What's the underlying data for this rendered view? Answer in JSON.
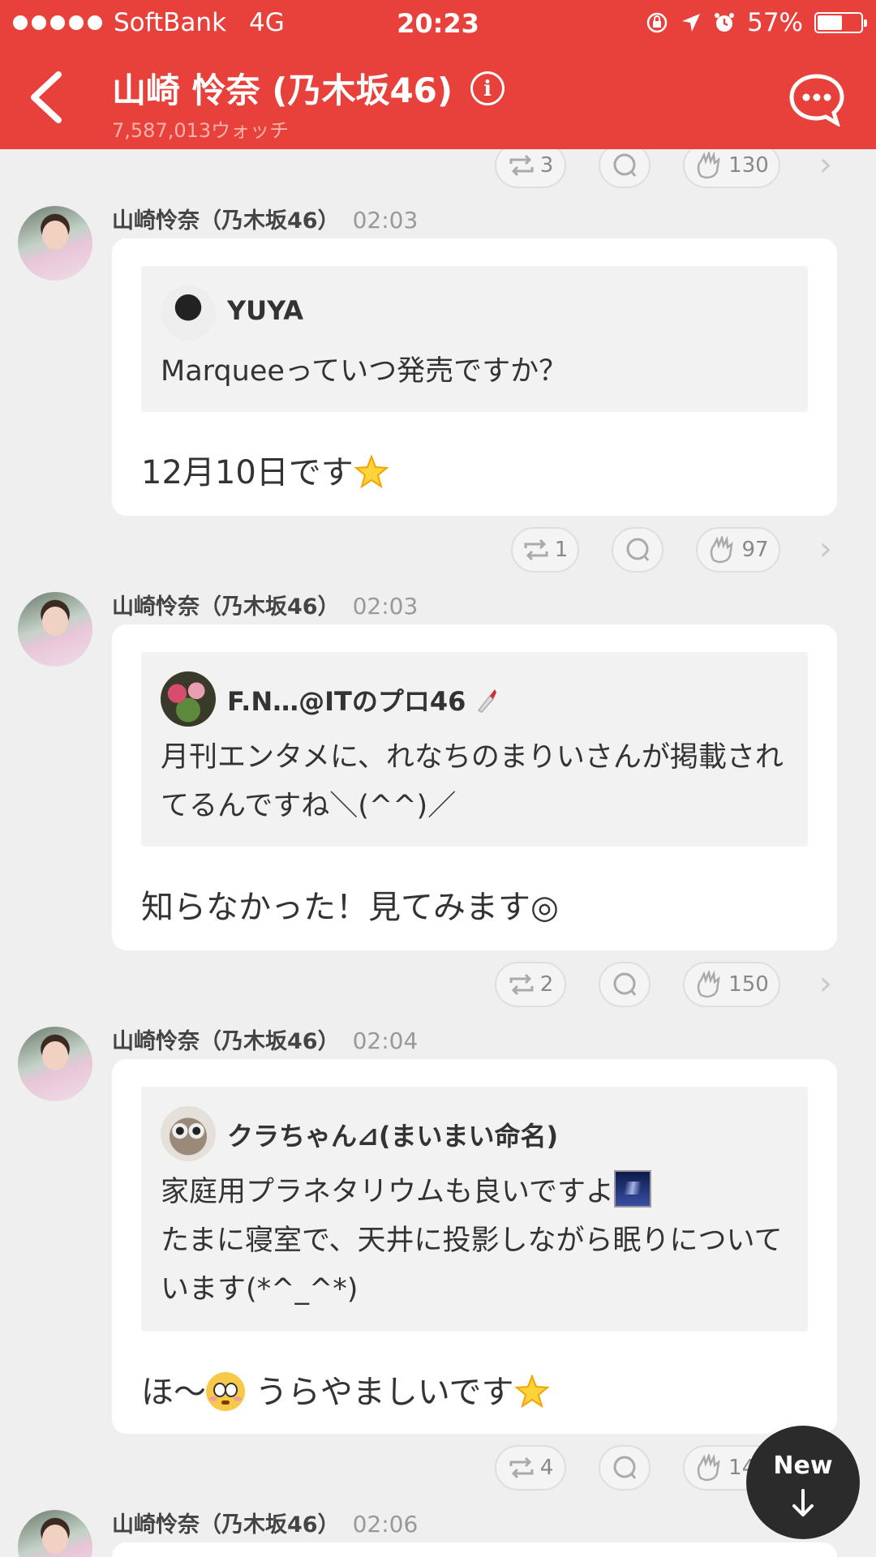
{
  "status_bar": {
    "carrier": "SoftBank",
    "network": "4G",
    "time": "20:23",
    "battery": "57%",
    "battery_level": 0.57,
    "icons": [
      "lock-rotation-icon",
      "location-arrow-icon",
      "alarm-icon"
    ]
  },
  "nav": {
    "title": "山崎 怜奈 (乃木坂46)",
    "subtitle": "7,587,013ウォッチ",
    "accent": "#e8403a"
  },
  "feed": {
    "top_actions": {
      "repost": "3",
      "likes": "130"
    },
    "posts": [
      {
        "author": "山崎怜奈（乃木坂46）",
        "time": "02:03",
        "quote_name": "YUYA",
        "quote_text": "Marqueeっていつ発売ですか？",
        "reply": "12月10日です",
        "reply_emoji": "glowing-star-icon",
        "repost": "1",
        "likes": "97"
      },
      {
        "author": "山崎怜奈（乃木坂46）",
        "time": "02:03",
        "quote_name": "F.N…@ITのプロ46",
        "quote_text": "月刊エンタメに、れなちのまりいさんが掲載されてるんですね＼(^^)／",
        "reply": "知らなかった！見てみます◎",
        "repost": "2",
        "likes": "150"
      },
      {
        "author": "山崎怜奈（乃木坂46）",
        "time": "02:04",
        "quote_name": "クラちゃん⊿(まいまい命名)",
        "quote_text_1": "家庭用プラネタリウムも良いですよ",
        "quote_text_2": "たまに寝室で、天井に投影しながら眠りについています(*^_^*)",
        "reply_a": "ほ〜",
        "reply_b": " うらやましいです",
        "repost": "4",
        "likes": "140"
      },
      {
        "author": "山崎怜奈（乃木坂46）",
        "time": "02:06"
      }
    ]
  },
  "new_button": {
    "label": "New"
  }
}
